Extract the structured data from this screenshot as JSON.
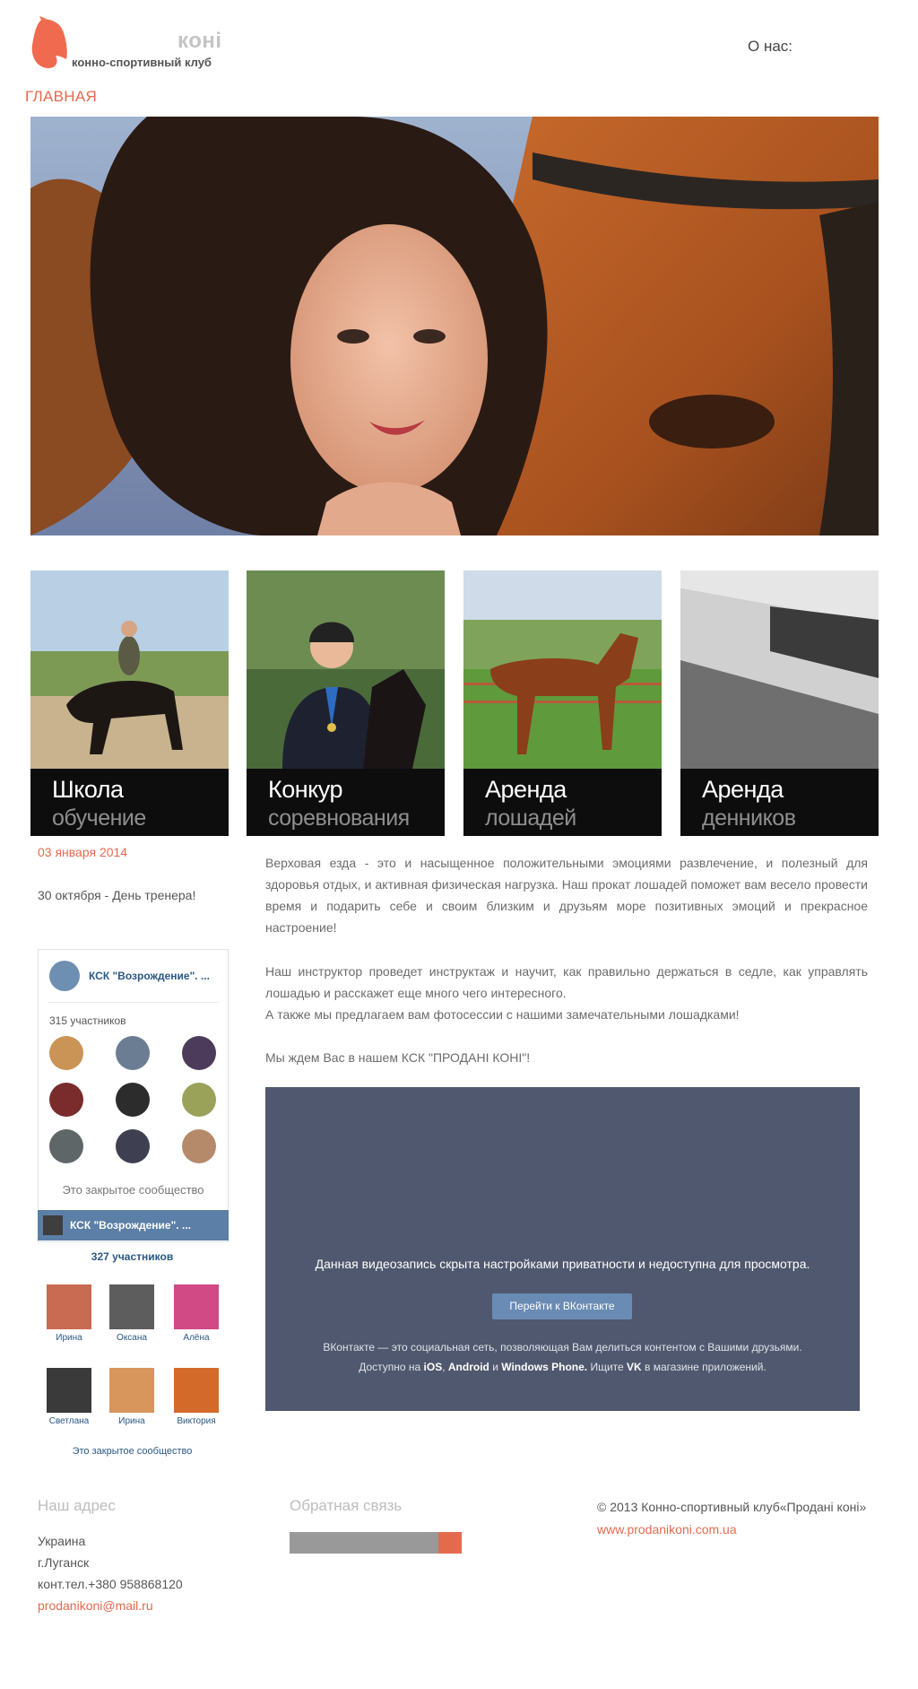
{
  "header": {
    "brand_name": "коні",
    "brand_subtitle": "конно-спортивный клуб",
    "nav_about": "О нас:",
    "nav_main": "ГЛАВНАЯ"
  },
  "colors": {
    "accent": "#e46a4e",
    "tile_caption_bg": "#0d0d0d",
    "vk_blue": "#5b7fa6",
    "video_bg": "#4f586e"
  },
  "tiles": [
    {
      "title": "Школа",
      "subtitle": "обучение"
    },
    {
      "title": "Конкур",
      "subtitle": "соревнования"
    },
    {
      "title": "Аренда",
      "subtitle": "лошадей"
    },
    {
      "title": "Аренда",
      "subtitle": "денников"
    }
  ],
  "sidebar": {
    "date": "03 января 2014",
    "news": "30 октября - День тренера!"
  },
  "vk_widget1": {
    "title": "КСК \"Возрождение\". ...",
    "members": "315 участников",
    "closed": "Это закрытое сообщество",
    "bar_label": "КСК \"Возрождение\". ..."
  },
  "vk_widget2": {
    "members": "327 участников",
    "people": [
      "Ирина",
      "Оксана",
      "Алёна",
      "Светлана",
      "Ирина",
      "Виктория"
    ],
    "closed": "Это закрытое сообщество"
  },
  "content": {
    "p1": "Верховая езда - это и насыщенное положительными эмоциями развлечение, и полезный для здоровья отдых, и активная физическая нагрузка. Наш прокат лошадей поможет вам весело провести время и подарить себе и своим близким и друзьям море позитивных эмоций и прекрасное настроение!",
    "p2a": "Наш инструктор проведет инструктаж и научит, как правильно держаться в седле, как управлять лошадью и расскажет еще много чего интересного.",
    "p2b": "А также мы предлагаем вам фотосессии с нашими замечательными лошадками!",
    "p3": "Мы ждем Вас в нашем КСК \"ПРОДАНІ КОНІ\"!"
  },
  "video": {
    "message": "Данная видеозапись скрыта настройками приватности и недоступна для просмотра.",
    "button": "Перейти к ВКонтакте",
    "line1": "ВКонтакте — это социальная сеть, позволяющая Вам делиться контентом с Вашими друзьями.",
    "line2_pre": "Доступно на ",
    "ios": "iOS",
    "comma": ", ",
    "android": "Android",
    "and": " и ",
    "wp": "Windows Phone.",
    "search": " Ищите ",
    "vk": "VK",
    "store": " в магазине приложений."
  },
  "footer": {
    "address_title": "Наш адрес",
    "country": "Украина",
    "city": "г.Луганск",
    "phone": "конт.тел.+380 958868120",
    "email": "prodanikoni@mail.ru",
    "feedback_title": "Обратная связь",
    "copyright": "© 2013 Конно-спортивный клуб«Продані коні»",
    "site": "www.prodanikoni.com.ua"
  }
}
